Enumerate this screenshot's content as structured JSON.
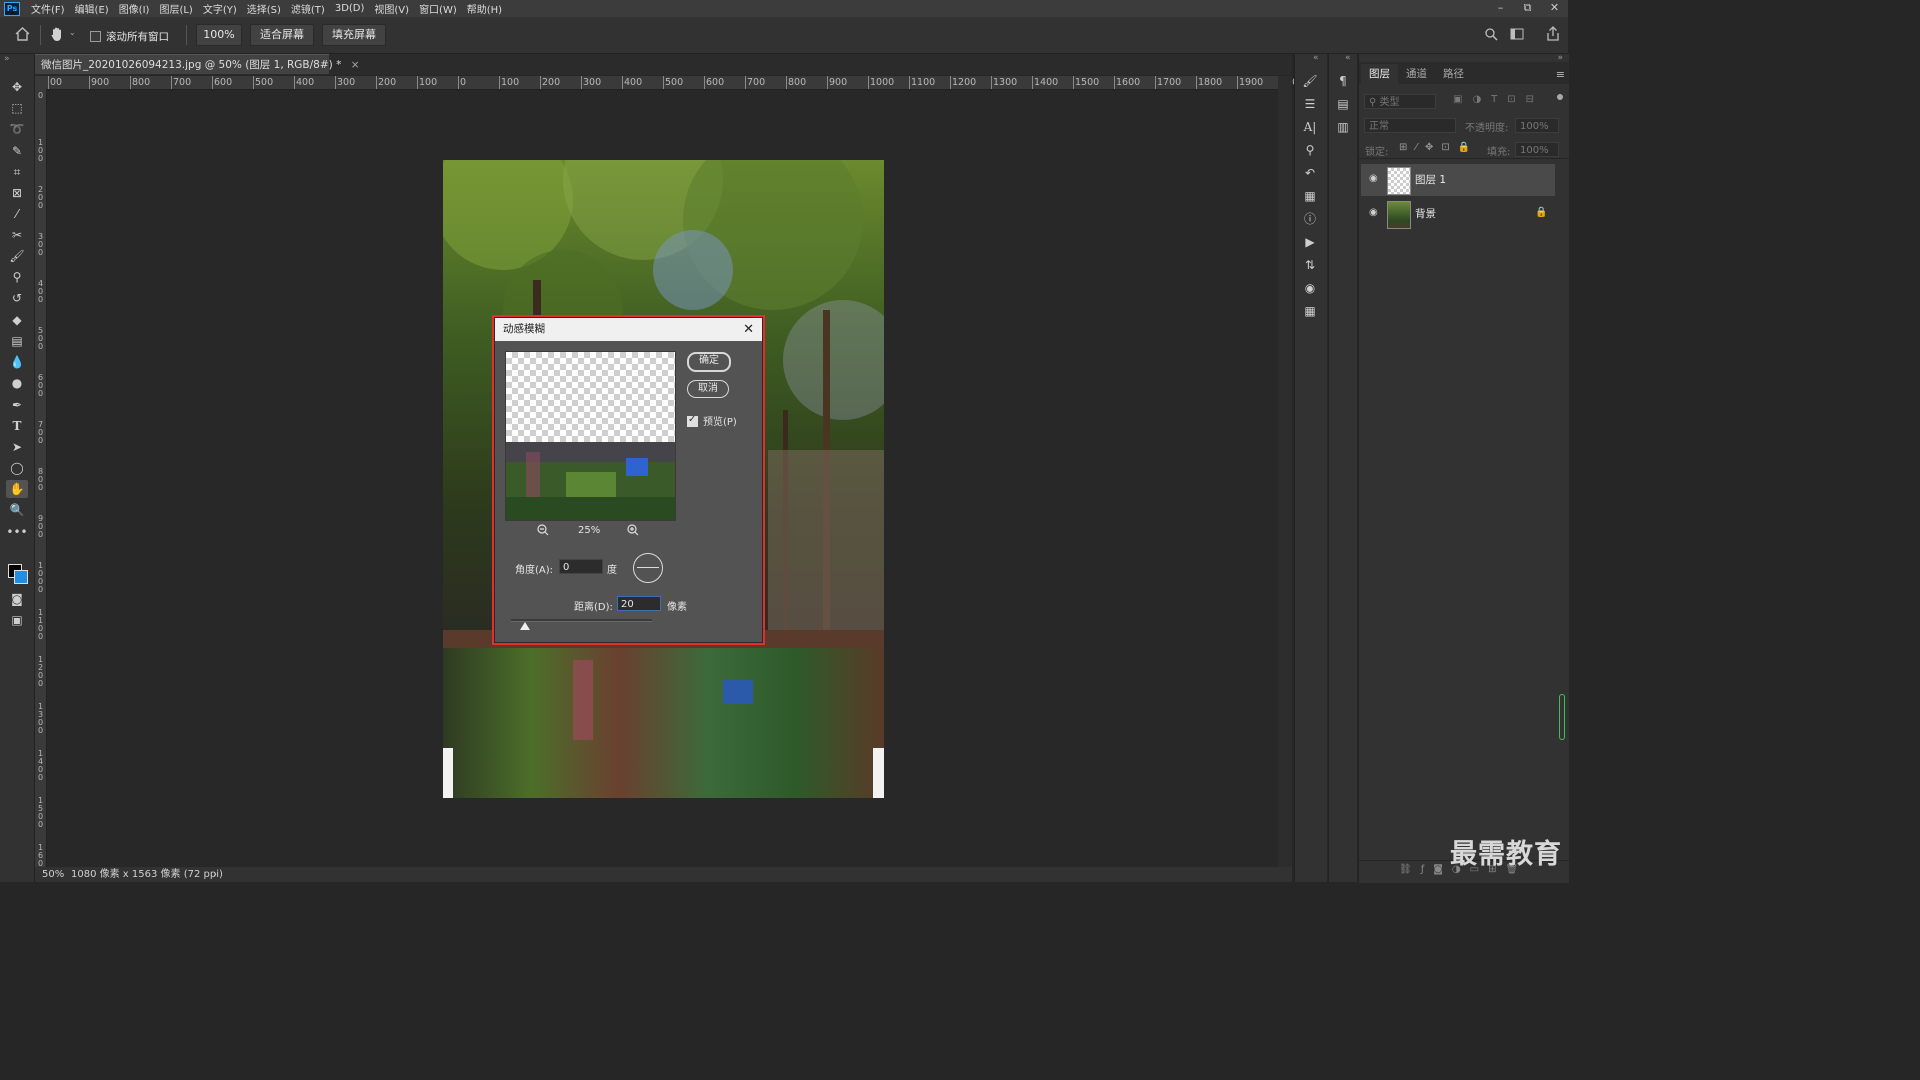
{
  "app": {
    "logo": "Ps",
    "menu": [
      "文件(F)",
      "编辑(E)",
      "图像(I)",
      "图层(L)",
      "文字(Y)",
      "选择(S)",
      "滤镜(T)",
      "3D(D)",
      "视图(V)",
      "窗口(W)",
      "帮助(H)"
    ],
    "window_controls": [
      "–",
      "⧉",
      "✕"
    ]
  },
  "options_bar": {
    "scroll_all_label": "滚动所有窗口",
    "zoom_100": "100%",
    "fit_screen": "适合屏幕",
    "fill_screen": "填充屏幕"
  },
  "document": {
    "tab_title": "微信图片_20201026094213.jpg @ 50% (图层 1, RGB/8#) *",
    "tab_close": "×",
    "ruler_h": [
      "00",
      "900",
      "800",
      "700",
      "600",
      "500",
      "400",
      "300",
      "200",
      "100",
      "0",
      "100",
      "200",
      "300",
      "400",
      "500",
      "600",
      "700",
      "800",
      "900",
      "1000",
      "1100",
      "1200",
      "1300",
      "1400",
      "1500",
      "1600",
      "1700",
      "1800",
      "1900",
      "200"
    ],
    "ruler_v": [
      "0",
      "100",
      "200",
      "300",
      "400",
      "500",
      "600",
      "700",
      "800",
      "900",
      "1000",
      "1100",
      "1200",
      "1300",
      "1400",
      "1500",
      "1600"
    ],
    "status_zoom": "50%",
    "status_info": "1080 像素 x 1563 像素 (72 ppi)",
    "status_arrow": "›"
  },
  "layers_panel": {
    "tabs": [
      "图层",
      "通道",
      "路径"
    ],
    "kind_placeholder": "类型",
    "blend_mode": "正常",
    "opacity_label": "不透明度:",
    "opacity_value": "100%",
    "lock_label": "锁定:",
    "fill_label": "填充:",
    "fill_value": "100%",
    "layers": [
      {
        "name": "图层 1",
        "selected": true
      },
      {
        "name": "背景",
        "locked": true
      }
    ]
  },
  "dialog": {
    "title": "动感模糊",
    "ok": "确定",
    "cancel": "取消",
    "preview_label": "预览(P)",
    "zoom": "25%",
    "angle_label": "角度(A):",
    "angle_value": "0",
    "angle_unit": "度",
    "distance_label": "距离(D):",
    "distance_value": "20",
    "distance_unit": "像素",
    "slider_fraction": 0.1
  },
  "watermark": "最需教育",
  "colors": {
    "accent_red": "#e52d2d",
    "foreground": "#000000",
    "background_swatch": "#1f8fe6"
  }
}
